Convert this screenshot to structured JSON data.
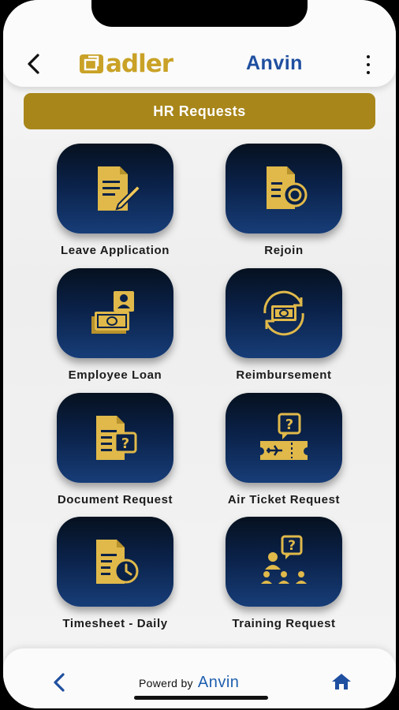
{
  "header": {
    "logo_text": "adler",
    "brand_name": "Anvin"
  },
  "section_title": "HR Requests",
  "tiles": [
    {
      "label": "Leave Application",
      "icon": "document-pen-icon"
    },
    {
      "label": "Rejoin",
      "icon": "document-coin-icon"
    },
    {
      "label": "Employee Loan",
      "icon": "cash-person-icon"
    },
    {
      "label": "Reimbursement",
      "icon": "cash-cycle-icon"
    },
    {
      "label": "Document Request",
      "icon": "document-question-icon"
    },
    {
      "label": "Air Ticket Request",
      "icon": "ticket-question-icon"
    },
    {
      "label": "Timesheet - Daily",
      "icon": "document-clock-icon"
    },
    {
      "label": "Training Request",
      "icon": "training-question-icon"
    }
  ],
  "footer": {
    "powered_label": "Powerd by",
    "powered_brand": "Anvin"
  },
  "colors": {
    "gold": "#c9a227",
    "title_bar": "#a8861a",
    "brand_blue": "#1f4fa0",
    "tile_top": "#06111f",
    "tile_bottom": "#173d78"
  }
}
